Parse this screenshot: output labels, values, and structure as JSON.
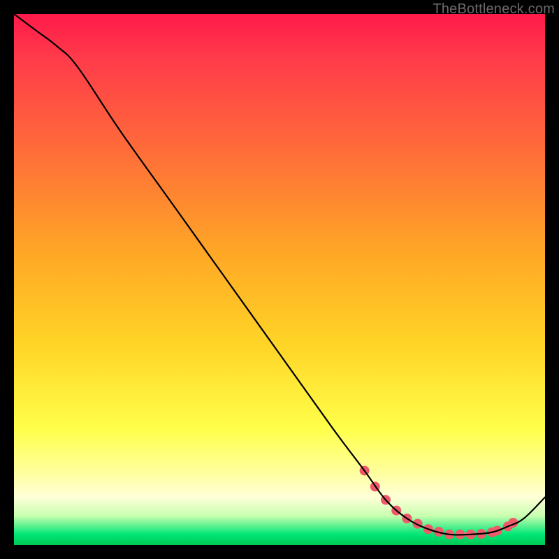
{
  "watermark": "TheBottleneck.com",
  "chart_data": {
    "type": "line",
    "title": "",
    "xlabel": "",
    "ylabel": "",
    "xlim": [
      0,
      100
    ],
    "ylim": [
      0,
      100
    ],
    "background": "rainbow-vertical-gradient",
    "series": [
      {
        "name": "curve",
        "color": "#000000",
        "x": [
          0,
          4,
          8,
          12,
          20,
          30,
          40,
          50,
          60,
          66,
          70,
          74,
          78,
          82,
          86,
          90,
          93,
          96,
          100
        ],
        "y": [
          100,
          97,
          94,
          90,
          78,
          64,
          50,
          36,
          22,
          14,
          8.5,
          5,
          3,
          2,
          2,
          2.4,
          3.5,
          5,
          9
        ]
      }
    ],
    "markers": [
      {
        "name": "dots",
        "color": "#ef5a6a",
        "radius": 7,
        "x": [
          66,
          68,
          70,
          72,
          74,
          76,
          78,
          80,
          82,
          84,
          86,
          88,
          90,
          91,
          93,
          94
        ],
        "y": [
          14,
          11,
          8.5,
          6.5,
          5,
          4,
          3,
          2.5,
          2,
          2,
          2,
          2.1,
          2.4,
          2.7,
          3.5,
          4.2
        ]
      }
    ]
  }
}
